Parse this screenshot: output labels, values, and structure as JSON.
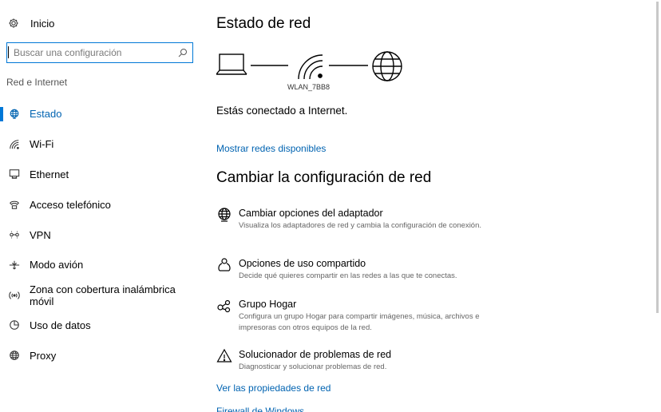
{
  "sidebar": {
    "home_label": "Inicio",
    "search_placeholder": "Buscar una configuración",
    "section_label": "Red e Internet",
    "items": [
      {
        "label": "Estado",
        "icon": "globe-icon",
        "active": true
      },
      {
        "label": "Wi-Fi",
        "icon": "wifi-icon"
      },
      {
        "label": "Ethernet",
        "icon": "ethernet-icon"
      },
      {
        "label": "Acceso telefónico",
        "icon": "dialup-icon"
      },
      {
        "label": "VPN",
        "icon": "vpn-icon"
      },
      {
        "label": "Modo avión",
        "icon": "airplane-icon"
      },
      {
        "label": "Zona con cobertura inalámbrica móvil",
        "icon": "hotspot-icon"
      },
      {
        "label": "Uso de datos",
        "icon": "data-usage-icon"
      },
      {
        "label": "Proxy",
        "icon": "proxy-globe-icon"
      }
    ]
  },
  "main": {
    "title": "Estado de red",
    "network_name": "WLAN_7BB8",
    "connection_status": "Estás conectado a Internet.",
    "show_networks_link": "Mostrar redes disponibles",
    "change_title": "Cambiar la configuración de red",
    "options": [
      {
        "title": "Cambiar opciones del adaptador",
        "desc": "Visualiza los adaptadores de red y cambia la configuración de conexión.",
        "icon": "adapter-globe-icon"
      },
      {
        "title": "Opciones de uso compartido",
        "desc": "Decide qué quieres compartir en las redes a las que te conectas.",
        "icon": "sharing-icon"
      },
      {
        "title": "Grupo Hogar",
        "desc": "Configura un grupo Hogar para compartir imágenes, música, archivos e impresoras con otros equipos de la red.",
        "icon": "homegroup-icon"
      },
      {
        "title": "Solucionador de problemas de red",
        "desc": "Diagnosticar y solucionar problemas de red.",
        "icon": "warning-icon"
      }
    ],
    "properties_link": "Ver las propiedades de red",
    "firewall_link": "Firewall de Windows"
  },
  "colors": {
    "accent": "#0078d7",
    "link": "#0063b1"
  }
}
